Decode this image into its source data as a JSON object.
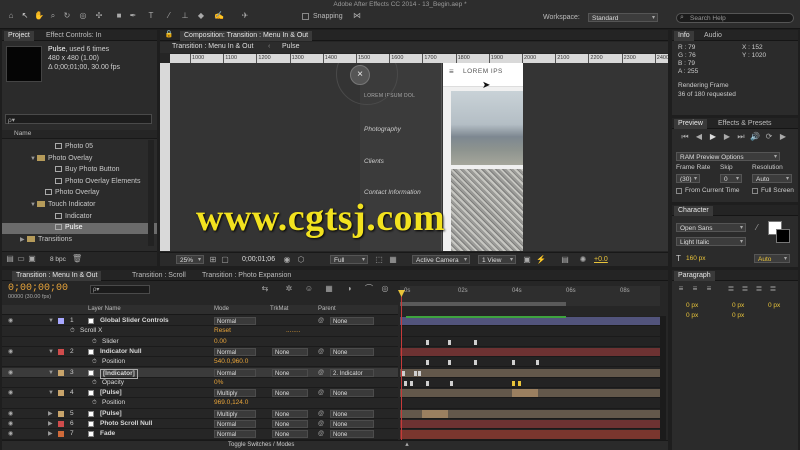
{
  "app_title": "Adobe After Effects CC 2014 - 13_Begin.aep *",
  "toolbar": {
    "snapping_label": "Snapping",
    "workspace_label": "Workspace:",
    "workspace_value": "Standard",
    "search_placeholder": "Search Help"
  },
  "project_panel": {
    "tabs": [
      "Project",
      "Effect Controls: In"
    ],
    "item_name": "Pulse",
    "item_used": ", used 6 times",
    "item_dims": "480 x 480 (1.00)",
    "item_dur": "Δ 0;00;01;00, 30.00 fps",
    "search_placeholder": "ρ▾",
    "column_name": "Name",
    "items": [
      {
        "label": "Photo 05",
        "kind": "comp",
        "indent": 46
      },
      {
        "label": "Photo Overlay",
        "kind": "folder",
        "indent": 28
      },
      {
        "label": "Buy Photo Button",
        "kind": "comp",
        "indent": 46
      },
      {
        "label": "Photo Overlay Elements",
        "kind": "comp",
        "indent": 46
      },
      {
        "label": "Photo Overlay",
        "kind": "comp",
        "indent": 36
      },
      {
        "label": "Touch Indicator",
        "kind": "folder",
        "indent": 28
      },
      {
        "label": "Indicator",
        "kind": "comp",
        "indent": 46
      },
      {
        "label": "Pulse",
        "kind": "comp",
        "indent": 46,
        "selected": true
      },
      {
        "label": "Transitions",
        "kind": "folder",
        "indent": 18
      }
    ],
    "footer_bpc": "8 bpc"
  },
  "comp_panel": {
    "tab_label": "Composition: Transition : Menu In & Out",
    "breadcrumb_parent": "Transition : Menu In & Out",
    "breadcrumb_child": "Pulse",
    "ruler_labels": [
      "1000",
      "1100",
      "1200",
      "1300",
      "1400",
      "1500",
      "1600",
      "1700",
      "1800",
      "1900",
      "2000",
      "2100",
      "2200",
      "2300",
      "2400"
    ],
    "zoom": "25%",
    "timecode": "0;00;01;06",
    "resolution": "Full",
    "camera": "Active Camera",
    "views": "1 View",
    "exposure": "+0.0",
    "phone_menu": {
      "title": "LOREM IPS",
      "subtitle": "LOREM IPSUM DOL",
      "items": [
        "Photography",
        "Clients",
        "Contact Information"
      ]
    },
    "close_symbol": "×"
  },
  "info_panel": {
    "tabs": [
      "Info",
      "Audio"
    ],
    "r": "R : 79",
    "g": "G : 76",
    "b": "B : 79",
    "a": "A : 255",
    "x": "X : 152",
    "y": "Y : 1020",
    "render_label": "Rendering Frame",
    "render_progress": "36 of 180 requested"
  },
  "preview_panel": {
    "tabs": [
      "Preview",
      "Effects & Presets"
    ],
    "ram_options": "RAM Preview Options",
    "frame_rate_label": "Frame Rate",
    "skip_label": "Skip",
    "resolution_label": "Resolution",
    "frame_rate_value": "(30)",
    "skip_value": "0",
    "resolution_value": "Auto",
    "from_current": "From Current Time",
    "full_screen": "Full Screen"
  },
  "character_panel": {
    "tab": "Character",
    "font": "Open Sans",
    "style": "Light Italic",
    "size": "160 px",
    "leading": "Auto"
  },
  "paragraph_panel": {
    "tab": "Paragraph",
    "fields": [
      "0 px",
      "0 px",
      "0 px",
      "0 px",
      "0 px"
    ]
  },
  "timeline": {
    "tabs": [
      "Transition : Menu In & Out",
      "Transition : Scroll",
      "Transition : Photo Expansion"
    ],
    "current_time": "0;00;00;00",
    "fps_note": "00000 (30.00 fps)",
    "col_layer_name": "Layer Name",
    "col_mode": "Mode",
    "col_trkmat": "TrkMat",
    "col_parent": "Parent",
    "ruler_labels": [
      "0s",
      "02s",
      "04s",
      "06s",
      "08s"
    ],
    "footer": "Toggle Switches / Modes",
    "rows": [
      {
        "num": "1",
        "name": "Global Slider Controls",
        "mode": "Normal",
        "trk": "",
        "parent": "None",
        "color": "#a8a8ff",
        "type": "layer"
      },
      {
        "num": "",
        "name": "Scroll X",
        "mode": "Reset",
        "trk": "",
        "parent": "",
        "color": "",
        "type": "effect",
        "extra": "........"
      },
      {
        "num": "",
        "name": "Slider",
        "mode": "0.00",
        "trk": "",
        "parent": "",
        "color": "",
        "type": "prop"
      },
      {
        "num": "2",
        "name": "Indicator Null",
        "mode": "Normal",
        "trk": "None",
        "parent": "None",
        "color": "#cf4c4c",
        "type": "layer"
      },
      {
        "num": "",
        "name": "Position",
        "mode": "540.0,960.0",
        "trk": "",
        "parent": "",
        "color": "",
        "type": "prop"
      },
      {
        "num": "3",
        "name": "[Indicator]",
        "mode": "Normal",
        "trk": "None",
        "parent": "2. Indicator",
        "color": "#c8a46b",
        "type": "layer",
        "selected": true
      },
      {
        "num": "",
        "name": "Opacity",
        "mode": "0%",
        "trk": "",
        "parent": "",
        "color": "",
        "type": "prop"
      },
      {
        "num": "4",
        "name": "[Pulse]",
        "mode": "Multiply",
        "trk": "None",
        "parent": "None",
        "color": "#c8a46b",
        "type": "layer"
      },
      {
        "num": "",
        "name": "Position",
        "mode": "969.0,124.0",
        "trk": "",
        "parent": "",
        "color": "",
        "type": "prop"
      },
      {
        "num": "5",
        "name": "[Pulse]",
        "mode": "Multiply",
        "trk": "None",
        "parent": "None",
        "color": "#c8a46b",
        "type": "layer"
      },
      {
        "num": "6",
        "name": "Photo Scroll Null",
        "mode": "Normal",
        "trk": "None",
        "parent": "None",
        "color": "#cf4c4c",
        "type": "layer"
      },
      {
        "num": "7",
        "name": "Fade",
        "mode": "Normal",
        "trk": "None",
        "parent": "None",
        "color": "#cf6a3a",
        "type": "layer"
      }
    ]
  },
  "watermark": "www.cgtsj.com"
}
